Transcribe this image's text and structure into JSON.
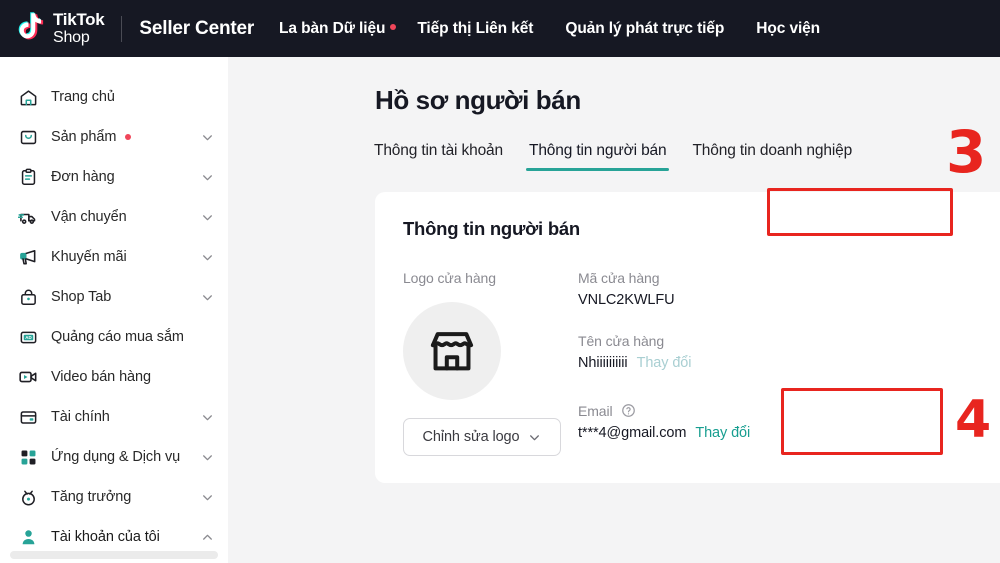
{
  "topbar": {
    "brand_line1": "TikTok",
    "brand_line2": "Shop",
    "seller_center": "Seller Center",
    "nav": [
      {
        "label": "La bàn Dữ liệu",
        "dot": true
      },
      {
        "label": "Tiếp thị Liên kết",
        "dot": false
      },
      {
        "label": "Quản lý phát trực tiếp",
        "dot": false
      },
      {
        "label": "Học viện",
        "dot": false
      }
    ]
  },
  "sidebar": {
    "items": [
      {
        "label": "Trang chủ",
        "icon": "home-icon",
        "chevron": "none",
        "dot": false,
        "active": false
      },
      {
        "label": "Sản phẩm",
        "icon": "product-icon",
        "chevron": "down",
        "dot": true,
        "active": false
      },
      {
        "label": "Đơn hàng",
        "icon": "orders-icon",
        "chevron": "down",
        "dot": false,
        "active": false
      },
      {
        "label": "Vận chuyển",
        "icon": "truck-icon",
        "chevron": "down",
        "dot": false,
        "active": false
      },
      {
        "label": "Khuyến mãi",
        "icon": "megaphone-icon",
        "chevron": "down",
        "dot": false,
        "active": false
      },
      {
        "label": "Shop Tab",
        "icon": "bag-icon",
        "chevron": "down",
        "dot": false,
        "active": false
      },
      {
        "label": "Quảng cáo mua sắm",
        "icon": "ad-icon",
        "chevron": "none",
        "dot": false,
        "active": false
      },
      {
        "label": "Video bán hàng",
        "icon": "video-icon",
        "chevron": "none",
        "dot": false,
        "active": false
      },
      {
        "label": "Tài chính",
        "icon": "finance-icon",
        "chevron": "down",
        "dot": false,
        "active": false
      },
      {
        "label": "Ứng dụng & Dịch vụ",
        "icon": "apps-icon",
        "chevron": "down",
        "dot": false,
        "active": false
      },
      {
        "label": "Tăng trưởng",
        "icon": "growth-icon",
        "chevron": "down",
        "dot": false,
        "active": false
      },
      {
        "label": "Tài khoản của tôi",
        "icon": "user-icon",
        "chevron": "up",
        "dot": false,
        "active": true
      }
    ]
  },
  "main": {
    "page_title": "Hồ sơ người bán",
    "tabs": [
      {
        "label": "Thông tin tài khoản",
        "active": false
      },
      {
        "label": "Thông tin người bán",
        "active": true
      },
      {
        "label": "Thông tin doanh nghiệp",
        "active": false
      }
    ],
    "card": {
      "title": "Thông tin người bán",
      "logo_label": "Logo cửa hàng",
      "logo_button": "Chỉnh sửa logo",
      "fields": [
        {
          "label": "Mã cửa hàng",
          "value": "VNLC2KWLFU",
          "action": "",
          "action_muted": false,
          "help": false
        },
        {
          "label": "Tên cửa hàng",
          "value": "Nhiiiiiiiiii",
          "action": "Thay đổi",
          "action_muted": true,
          "help": false
        },
        {
          "label": "Email",
          "value": "t***4@gmail.com",
          "action": "Thay đổi",
          "action_muted": false,
          "help": true
        }
      ]
    }
  },
  "annotations": [
    {
      "number": "3",
      "target": "tab-thong-tin-nguoi-ban"
    },
    {
      "number": "4",
      "target": "field-ten-cua-hang"
    }
  ],
  "colors": {
    "topbar_bg": "#161823",
    "accent_teal": "#27a397",
    "link_teal": "#189e90",
    "link_teal_muted": "#a9cfd2",
    "annotation_red": "#e8251f",
    "notification_dot": "#f0465a",
    "content_bg": "#f4f4f5"
  }
}
